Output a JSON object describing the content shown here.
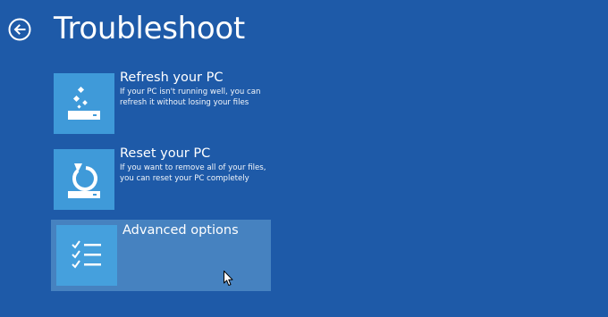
{
  "header": {
    "title": "Troubleshoot",
    "back_icon": "back-arrow-icon"
  },
  "options": [
    {
      "title": "Refresh your PC",
      "desc_line1": "If your PC isn't running well, you can",
      "desc_line2": "refresh it without losing your files",
      "icon": "refresh-sparkle-icon"
    },
    {
      "title": "Reset your PC",
      "desc_line1": "If you want to remove all of your files,",
      "desc_line2": "you can reset your PC completely",
      "icon": "reset-restore-icon"
    },
    {
      "title": "Advanced options",
      "icon": "checklist-icon",
      "selected": true
    }
  ],
  "colors": {
    "background": "#1e5aa8",
    "tile": "#3f9ad9",
    "selected_highlight": "#4682c0"
  }
}
